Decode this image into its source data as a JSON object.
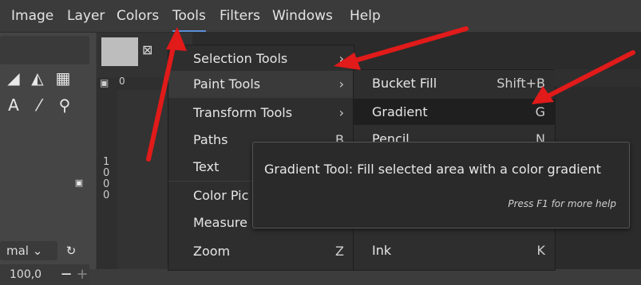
{
  "menubar": {
    "items": [
      "Image",
      "Layer",
      "Colors",
      "Tools",
      "Filters",
      "Windows",
      "Help"
    ],
    "active": "Tools"
  },
  "toolbox": {
    "mode_value": "mal",
    "opacity_value": "100,0"
  },
  "ruler": {
    "vertical_labels": [
      "1",
      "0",
      "0",
      "0"
    ],
    "top_label": "0"
  },
  "tools_menu": {
    "items": [
      {
        "label": "Selection Tools",
        "accel": "›"
      },
      {
        "label": "Paint Tools",
        "accel": "›"
      },
      {
        "label": "Transform Tools",
        "accel": "›"
      },
      {
        "label": "Paths",
        "accel": "B"
      },
      {
        "label": "Text",
        "accel": ""
      },
      {
        "label": "Color Pic",
        "accel": ""
      },
      {
        "label": "Measure",
        "accel": ""
      },
      {
        "label": "Zoom",
        "accel": "Z"
      }
    ]
  },
  "paint_menu": {
    "items": [
      {
        "label": "Bucket Fill",
        "accel": "Shift+B"
      },
      {
        "label": "Gradient",
        "accel": "G"
      },
      {
        "label": "Pencil",
        "accel": "N"
      },
      {
        "label": "Ink",
        "accel": "K"
      }
    ]
  },
  "tooltip": {
    "text": "Gradient Tool: Fill selected area with a color gradient",
    "help": "Press F1 for more help"
  },
  "colors": {
    "arrow": "#e11a1a",
    "accent": "#5b8fd6"
  }
}
